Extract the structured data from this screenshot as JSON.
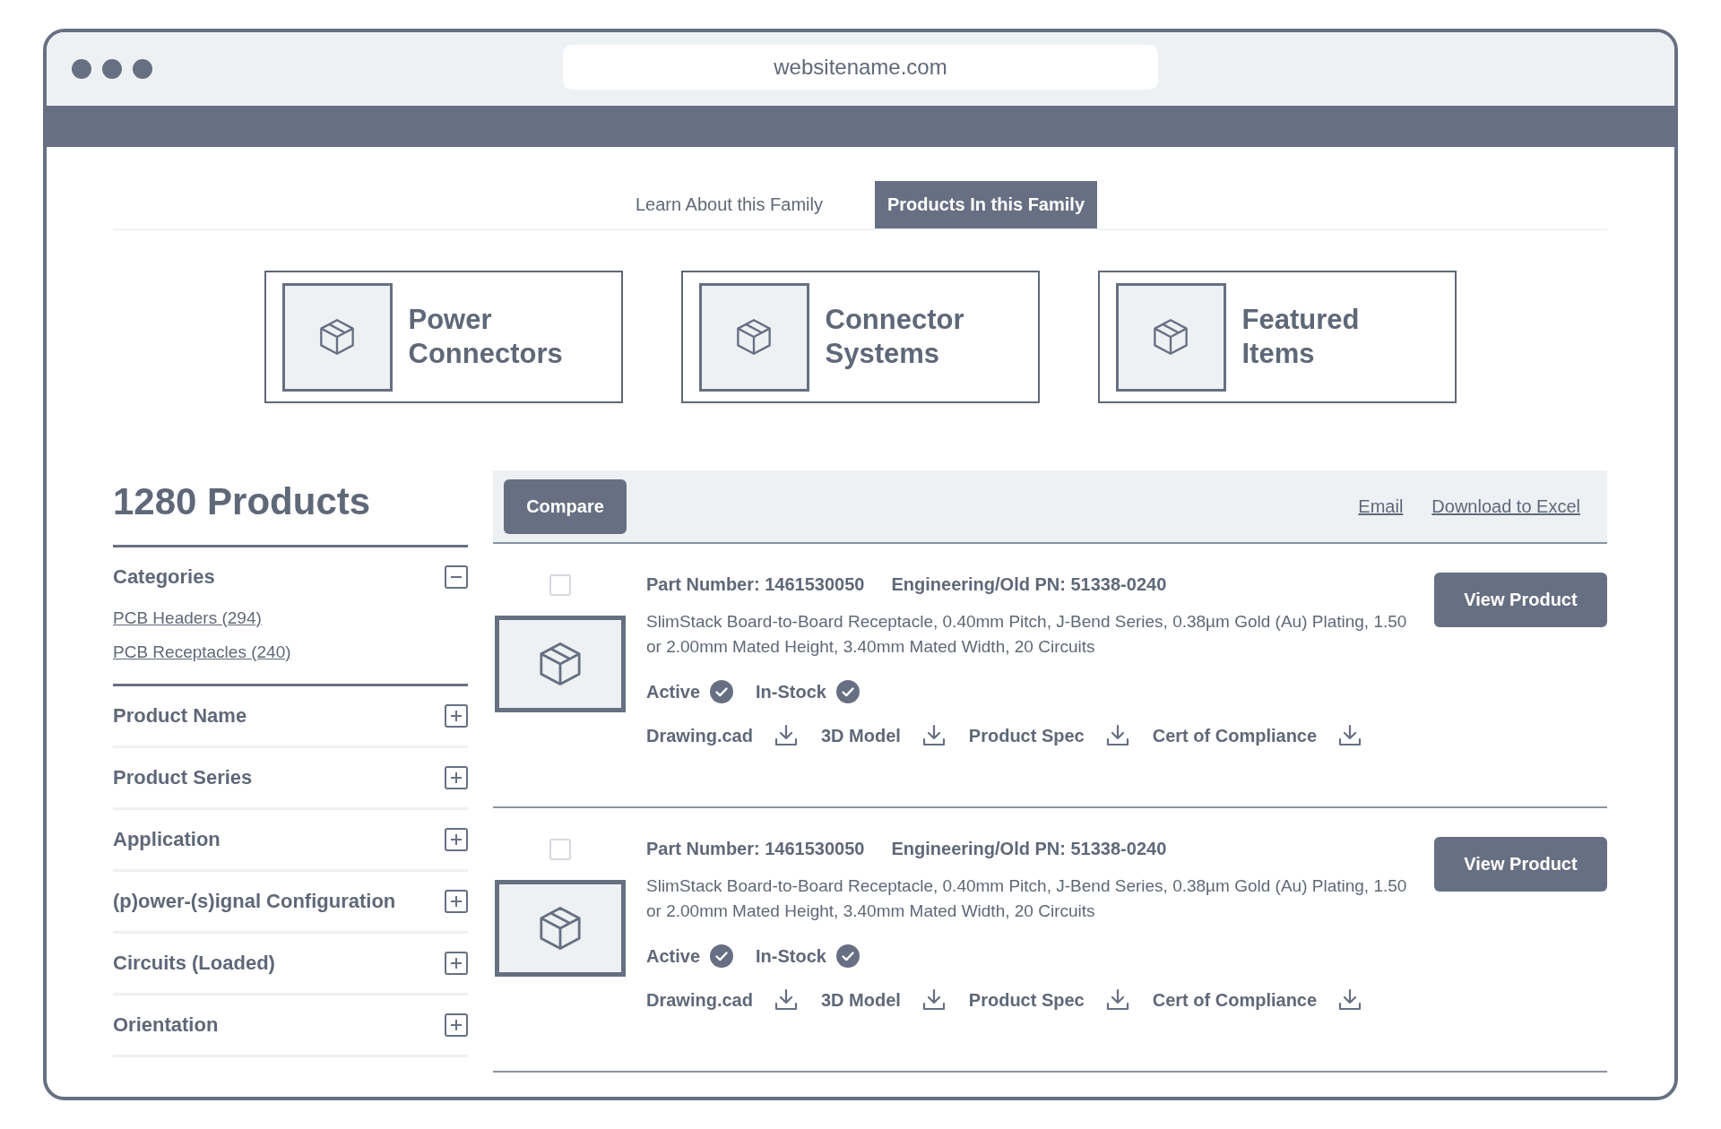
{
  "browser": {
    "url": "websitename.com"
  },
  "tabs": [
    {
      "label": "Learn About this Family",
      "selected": false
    },
    {
      "label": "Products In this Family",
      "selected": true
    }
  ],
  "category_cards": [
    {
      "title": "Power Connectors"
    },
    {
      "title": "Connector Systems"
    },
    {
      "title": "Featured Items"
    }
  ],
  "sidebar": {
    "heading": "1280 Products",
    "filters": [
      {
        "label": "Categories",
        "expanded": true,
        "options": [
          "PCB Headers (294)",
          "PCB Receptacles (240)"
        ]
      },
      {
        "label": "Product Name",
        "expanded": false
      },
      {
        "label": "Product Series",
        "expanded": false
      },
      {
        "label": "Application",
        "expanded": false
      },
      {
        "label": "(p)ower-(s)ignal Configuration",
        "expanded": false
      },
      {
        "label": "Circuits (Loaded)",
        "expanded": false
      },
      {
        "label": "Orientation",
        "expanded": false
      }
    ]
  },
  "toolbar": {
    "button": "Compare",
    "links": [
      "Email",
      "Download to Excel"
    ]
  },
  "products": [
    {
      "checked": false,
      "part_number": "Part Number: 1461530050",
      "engineering_pn": "Engineering/Old PN: 51338-0240",
      "description": "SlimStack Board-to-Board Receptacle, 0.40mm Pitch, J-Bend Series, 0.38µm Gold (Au) Plating, 1.50 or 2.00mm Mated Height, 3.40mm Mated Width, 20 Circuits",
      "statuses": [
        {
          "label": "Active",
          "on": true
        },
        {
          "label": "In-Stock",
          "on": true
        }
      ],
      "downloads": [
        "Drawing.cad",
        "3D Model",
        "Product Spec",
        "Cert of Compliance"
      ],
      "button": "View Product"
    },
    {
      "checked": false,
      "part_number": "Part Number: 1461530050",
      "engineering_pn": "Engineering/Old PN: 51338-0240",
      "description": "SlimStack Board-to-Board Receptacle, 0.40mm Pitch, J-Bend Series, 0.38µm Gold (Au) Plating, 1.50 or 2.00mm Mated Height, 3.40mm Mated Width, 20 Circuits",
      "statuses": [
        {
          "label": "Active",
          "on": true
        },
        {
          "label": "In-Stock",
          "on": true
        }
      ],
      "downloads": [
        "Drawing.cad",
        "3D Model",
        "Product Spec",
        "Cert of Compliance"
      ],
      "button": "View Product"
    }
  ]
}
